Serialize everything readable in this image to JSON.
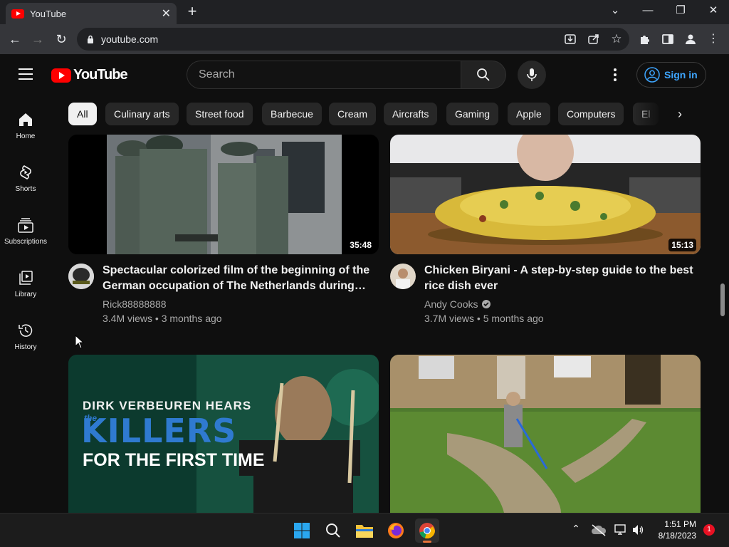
{
  "browser": {
    "tab_title": "YouTube",
    "url": "youtube.com"
  },
  "header": {
    "logo_text": "YouTube",
    "search_placeholder": "Search",
    "signin_label": "Sign in"
  },
  "chips": [
    "All",
    "Culinary arts",
    "Street food",
    "Barbecue",
    "Cream",
    "Aircrafts",
    "Gaming",
    "Apple",
    "Computers",
    "El"
  ],
  "sidebar": {
    "items": [
      {
        "label": "Home",
        "icon": "home-icon"
      },
      {
        "label": "Shorts",
        "icon": "shorts-icon"
      },
      {
        "label": "Subscriptions",
        "icon": "subscriptions-icon"
      },
      {
        "label": "Library",
        "icon": "library-icon"
      },
      {
        "label": "History",
        "icon": "history-icon"
      }
    ]
  },
  "videos": [
    {
      "title_line1": "Spectacular colorized film of the beginning of the",
      "title_line2": "German occupation of The Netherlands during…",
      "channel": "Rick88888888",
      "views": "3.4M views",
      "age": "3 months ago",
      "duration": "35:48",
      "verified": false
    },
    {
      "title_line1": "Chicken Biryani - A step-by-step guide to the best",
      "title_line2": "rice dish ever",
      "channel": "Andy Cooks",
      "views": "3.7M views",
      "age": "5 months ago",
      "duration": "15:13",
      "verified": true
    },
    {
      "thumb_text_line1": "DIRK VERBEUREN HEARS",
      "thumb_text_small": "the",
      "thumb_text_line2": "KILLERS",
      "thumb_text_line3": "FOR THE FIRST TIME"
    },
    {
      "thumb_description": ""
    }
  ],
  "taskbar": {
    "time": "1:51 PM",
    "date": "8/18/2023",
    "notification_count": "1"
  },
  "colors": {
    "background": "#0f0f0f",
    "brand_red": "#ff0000",
    "link_blue": "#3ea6ff",
    "chip_bg": "#272727"
  }
}
